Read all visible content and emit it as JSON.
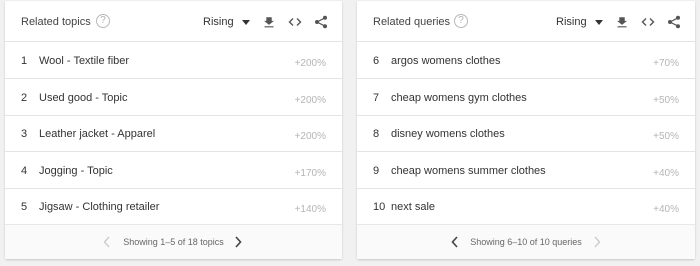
{
  "topics": {
    "title": "Related topics",
    "filter": "Rising",
    "rows": [
      {
        "rank": "1",
        "label": "Wool - Textile fiber",
        "value": "+200%"
      },
      {
        "rank": "2",
        "label": "Used good - Topic",
        "value": "+200%"
      },
      {
        "rank": "3",
        "label": "Leather jacket - Apparel",
        "value": "+200%"
      },
      {
        "rank": "4",
        "label": "Jogging - Topic",
        "value": "+170%"
      },
      {
        "rank": "5",
        "label": "Jigsaw - Clothing retailer",
        "value": "+140%"
      }
    ],
    "pagination": "Showing 1–5 of 18 topics"
  },
  "queries": {
    "title": "Related queries",
    "filter": "Rising",
    "rows": [
      {
        "rank": "6",
        "label": "argos womens clothes",
        "value": "+70%"
      },
      {
        "rank": "7",
        "label": "cheap womens gym clothes",
        "value": "+50%"
      },
      {
        "rank": "8",
        "label": "disney womens clothes",
        "value": "+50%"
      },
      {
        "rank": "9",
        "label": "cheap womens summer clothes",
        "value": "+40%"
      },
      {
        "rank": "10",
        "label": "next sale",
        "value": "+40%"
      }
    ],
    "pagination": "Showing 6–10 of 10 queries"
  },
  "icons": {
    "help": "?",
    "download": "download-icon",
    "embed": "embed-icon",
    "share": "share-icon",
    "prev": "chevron-left-icon",
    "next": "chevron-right-icon"
  },
  "colors": {
    "active_chevron": "#444444",
    "disabled_chevron": "#cccccc",
    "value_text": "#b5b5b5"
  }
}
